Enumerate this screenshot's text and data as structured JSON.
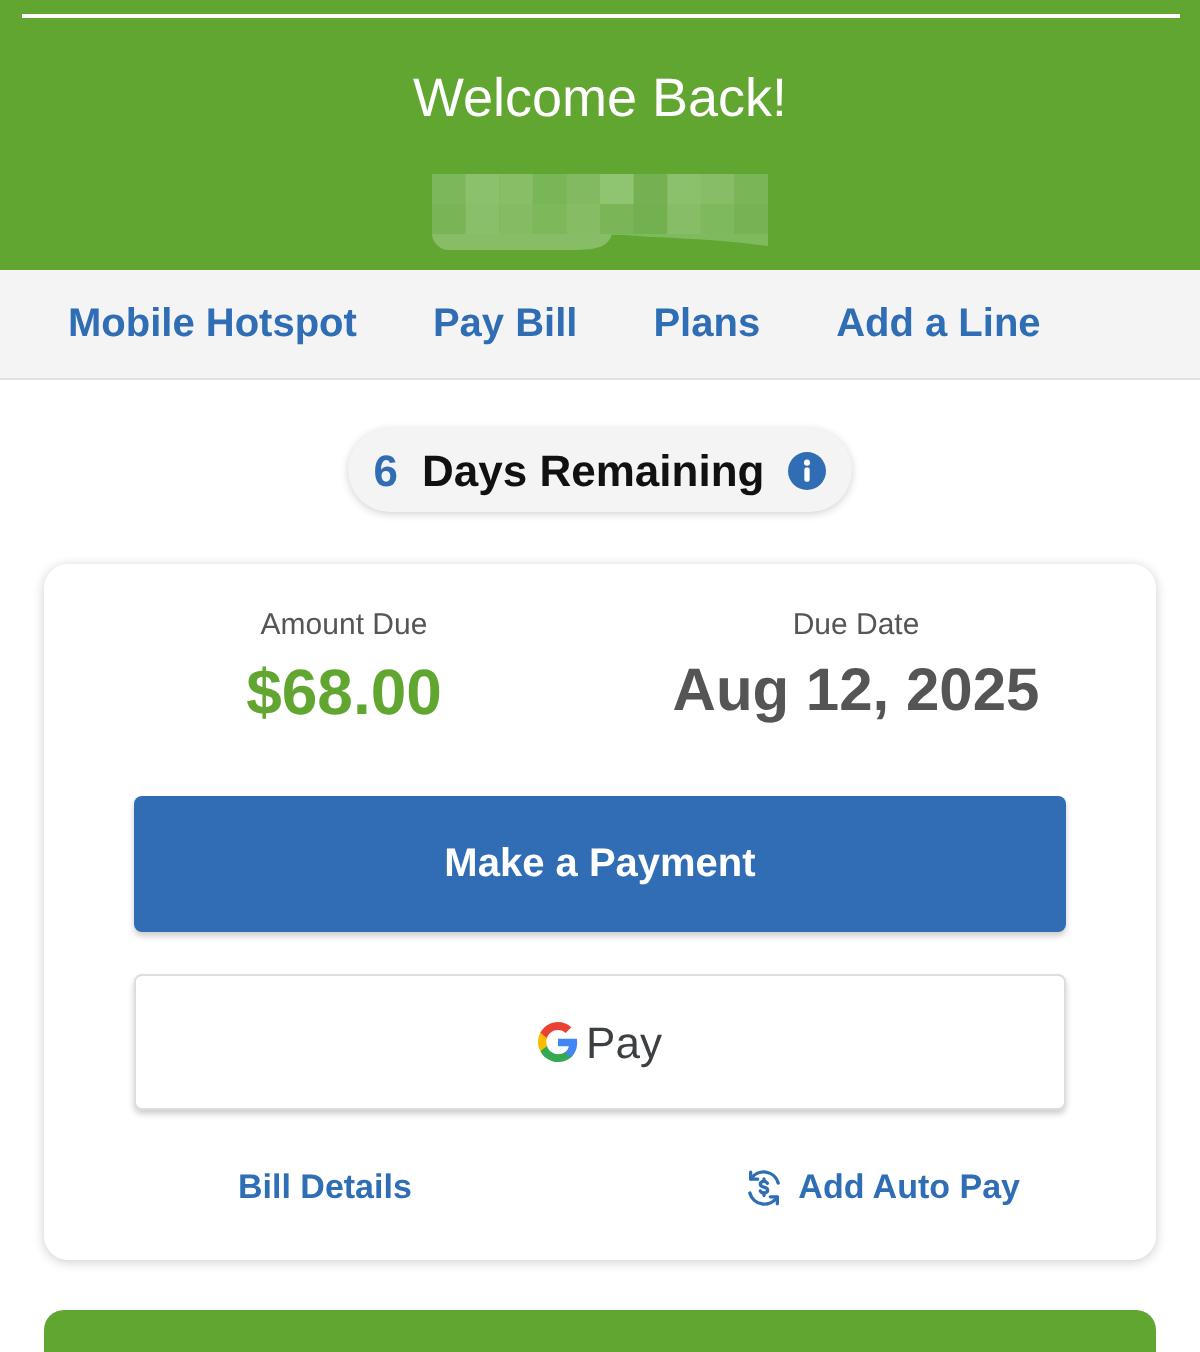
{
  "header": {
    "title": "Welcome Back!"
  },
  "nav": [
    "Mobile Hotspot",
    "Pay Bill",
    "Plans",
    "Add a Line"
  ],
  "days_remaining": {
    "count": "6",
    "label": "Days Remaining"
  },
  "bill": {
    "amount_label": "Amount Due",
    "amount": "$68.00",
    "due_label": "Due Date",
    "due_date": "Aug 12, 2025"
  },
  "buttons": [
    {
      "kind": "primary",
      "label": "Make a Payment"
    },
    {
      "kind": "gpay",
      "label": "Pay"
    }
  ],
  "links": [
    {
      "kind": "plain",
      "label": "Bill Details"
    },
    {
      "kind": "autopay",
      "label": "Add Auto Pay"
    }
  ]
}
